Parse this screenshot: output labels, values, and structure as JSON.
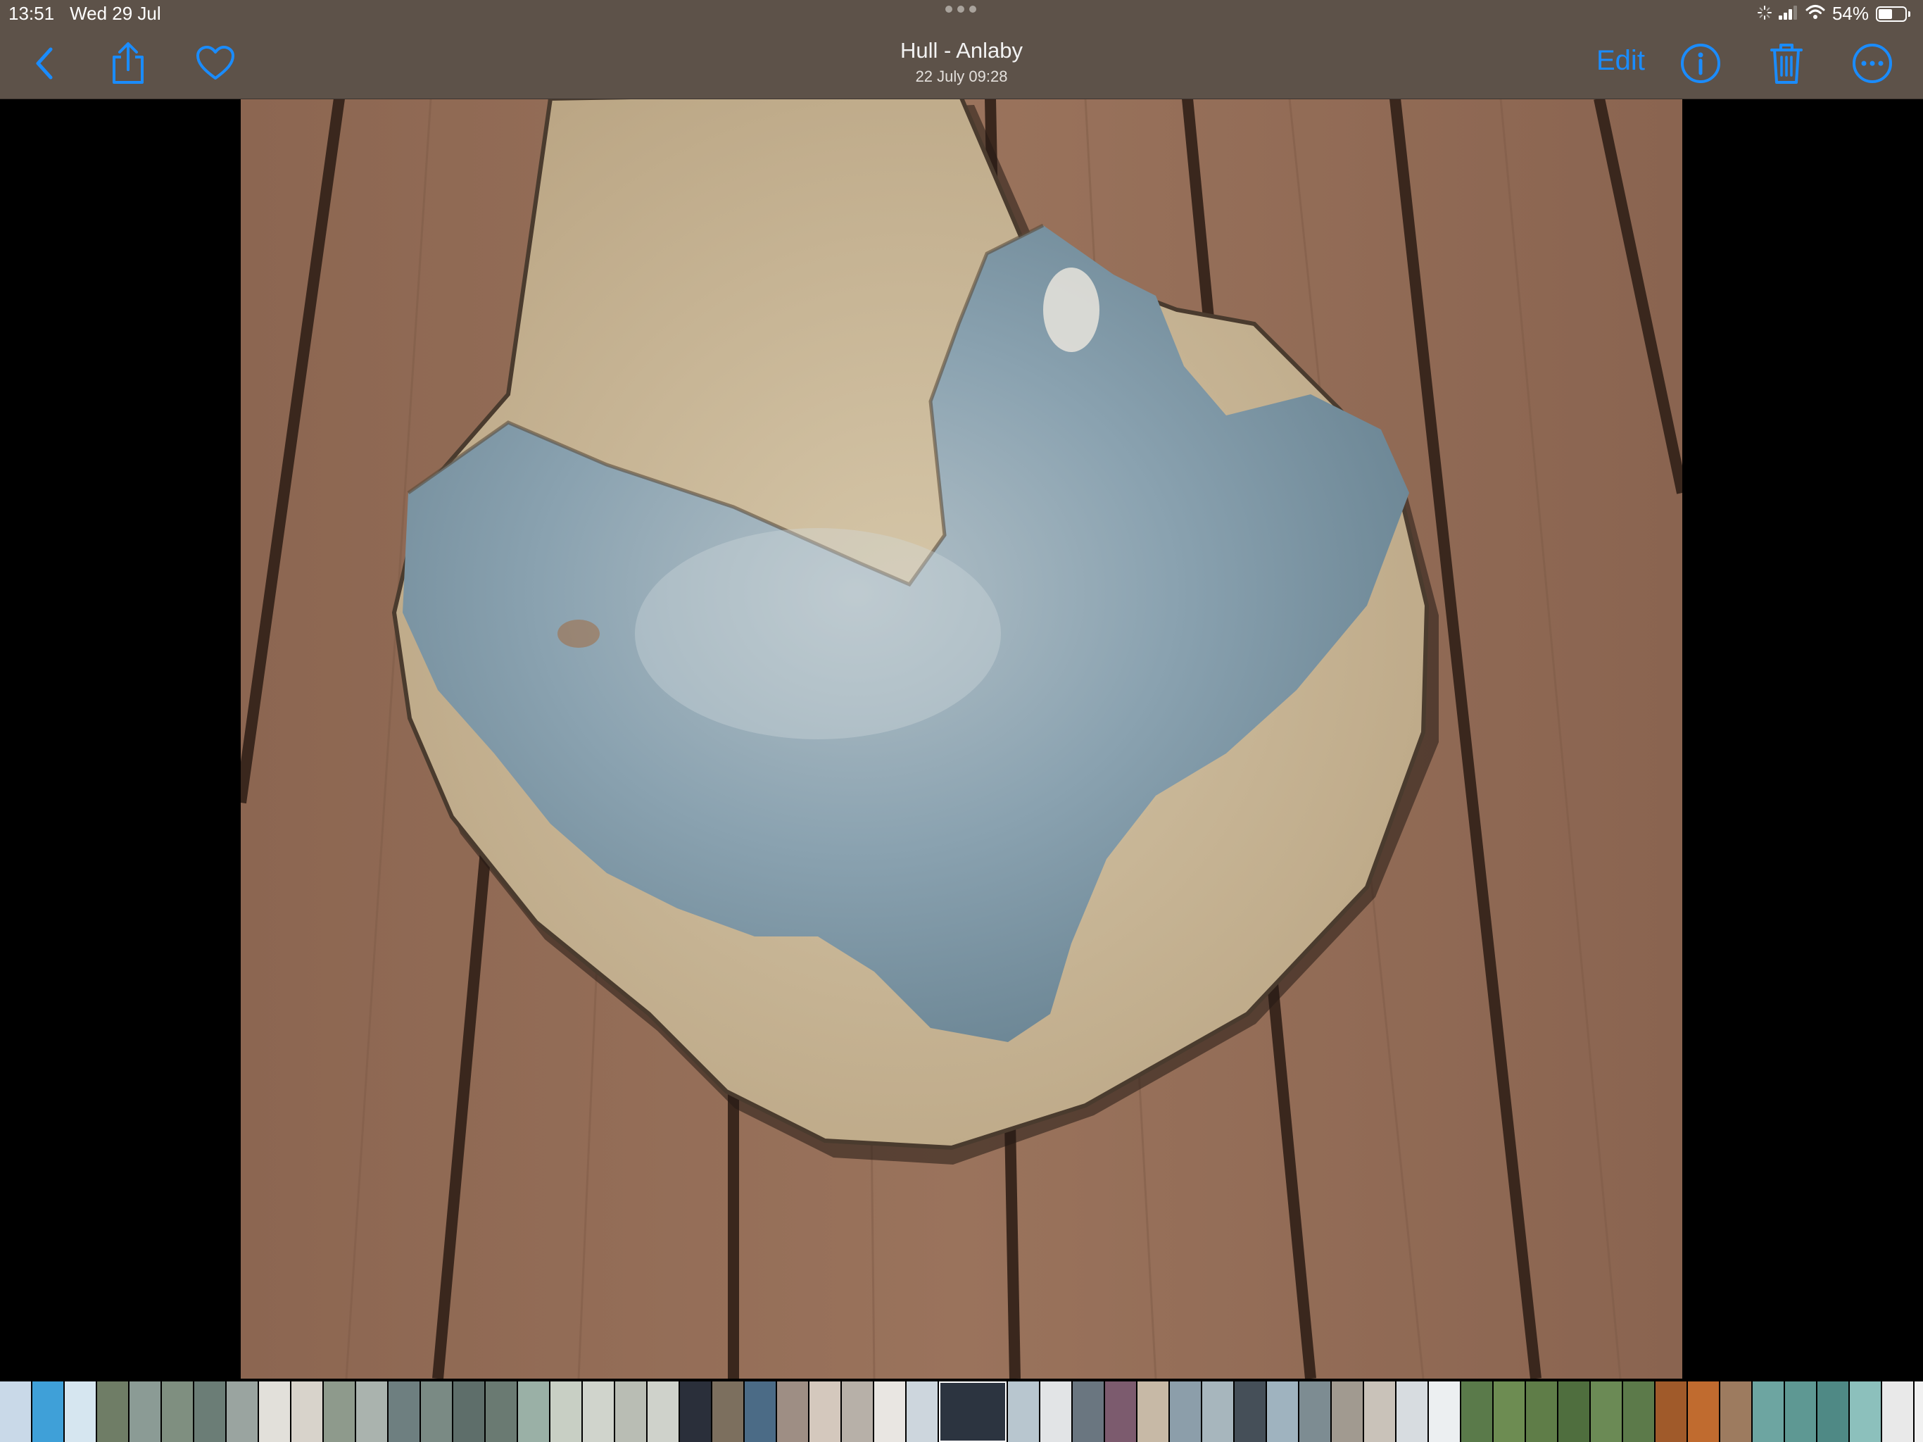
{
  "status_bar": {
    "time": "13:51",
    "date": "Wed 29 Jul",
    "battery_percent": "54%",
    "battery_level": 0.54,
    "icons": [
      "loading-icon",
      "signal-icon",
      "wifi-icon",
      "battery-icon"
    ]
  },
  "nav": {
    "title": "Hull - Anlaby",
    "subtitle": "22 July  09:28",
    "edit_label": "Edit",
    "accent_color": "#1a8cff",
    "icons": [
      "back-chevron-icon",
      "share-icon",
      "heart-icon",
      "info-icon",
      "trash-icon",
      "more-icon"
    ]
  },
  "photo": {
    "colors": {
      "wood": "#8f6a54",
      "gap": "#3a271d",
      "sand_glaze": "#c9b79a",
      "blue_glaze": "#7e97a6"
    }
  },
  "filmstrip": {
    "thumb_colors": [
      "#c9d9e8",
      "#3fa0d8",
      "#d6e6f0",
      "#6f7d66",
      "#8b9b95",
      "#7f8f80",
      "#6b7d76",
      "#9aa4a0",
      "#e2e0da",
      "#d8d3cb",
      "#8e9a8c",
      "#aab3ae",
      "#6e7f80",
      "#7a8a84",
      "#5e6e6a",
      "#6a7a72",
      "#9ab0a6",
      "#c8cfc4",
      "#d0d4cc",
      "#b9bdb4",
      "#cfd2cb",
      "#2a2f3a",
      "#7c6f5e",
      "#4b6b86",
      "#9e8e84",
      "#d4c8bd",
      "#b7b0a8",
      "#e9e6e2",
      "#cdd6dd",
      "#2c3440",
      "#b8c6cf",
      "#e2e4e6",
      "#6a7680",
      "#7c5b6e",
      "#c7b9a6",
      "#8c9eaa",
      "#a7b6bd",
      "#454f58",
      "#9fb3bf",
      "#7d8c92",
      "#a19a90",
      "#c9c2b9",
      "#d7dce0",
      "#eceff1",
      "#5a7a4a",
      "#6d8c52",
      "#5f7d48",
      "#4f6e3e",
      "#6b8a55",
      "#5c7a4a",
      "#a05a2a",
      "#c06b2f",
      "#9d7b5f",
      "#6da5a1",
      "#5e9893",
      "#4f8985",
      "#8cc0bc",
      "#e9e9e9",
      "#f1f1f1",
      "#dedede",
      "#f4f4f4",
      "#3f4d3a",
      "#6f6a5c",
      "#8b8b7a",
      "#a27a5f",
      "#8a3b2a",
      "#9ea3a7",
      "#c3b3a8",
      "#2e2f33",
      "#f0e6f2",
      "#c878c8",
      "#e8e8e8"
    ]
  }
}
